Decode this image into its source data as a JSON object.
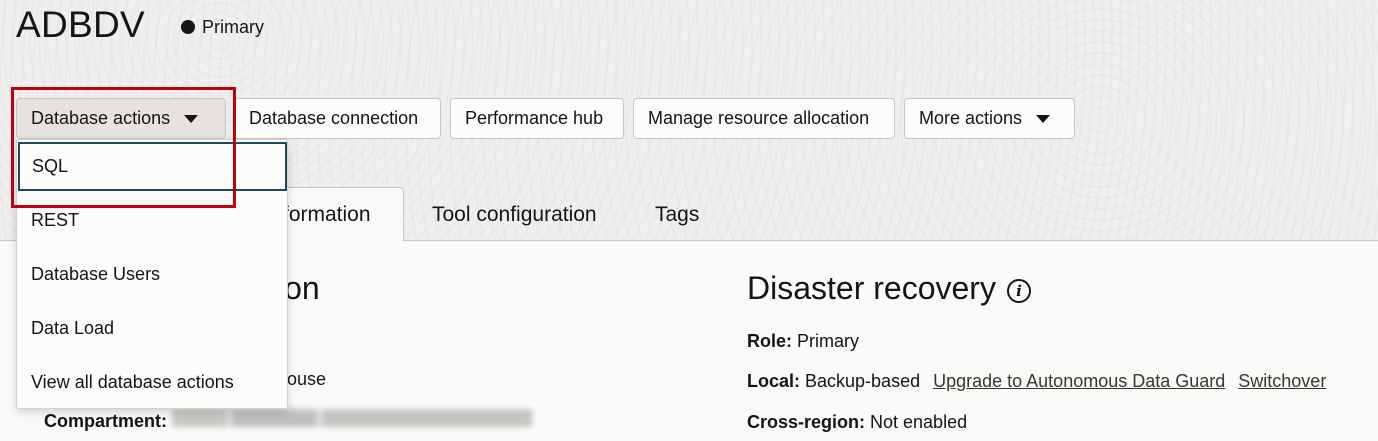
{
  "header": {
    "title": "ADBDV",
    "status": "Primary"
  },
  "toolbar": {
    "database_actions": "Database actions",
    "database_connection": "Database connection",
    "performance_hub": "Performance hub",
    "manage_resource_allocation": "Manage resource allocation",
    "more_actions": "More actions"
  },
  "tabs": {
    "partial_active": "formation",
    "tool_configuration": "Tool configuration",
    "tags": "Tags"
  },
  "dropdown": {
    "items": [
      "SQL",
      "REST",
      "Database Users",
      "Data Load",
      "View all database actions"
    ]
  },
  "left_section": {
    "title_partial": "ion",
    "workload_partial": "ouse",
    "compartment_label": "Compartment:"
  },
  "disaster_recovery": {
    "title": "Disaster recovery",
    "role_label": "Role:",
    "role_value": "Primary",
    "local_label": "Local:",
    "local_value": "Backup-based",
    "upgrade_link": "Upgrade to Autonomous Data Guard",
    "switchover_link": "Switchover",
    "cross_region_label": "Cross-region:",
    "cross_region_value": "Not enabled"
  },
  "colors": {
    "highlight": "#c0000b",
    "focus_ring": "#1e4b5a"
  },
  "icons": [
    "caret-down-icon",
    "info-icon",
    "status-dot-icon"
  ]
}
